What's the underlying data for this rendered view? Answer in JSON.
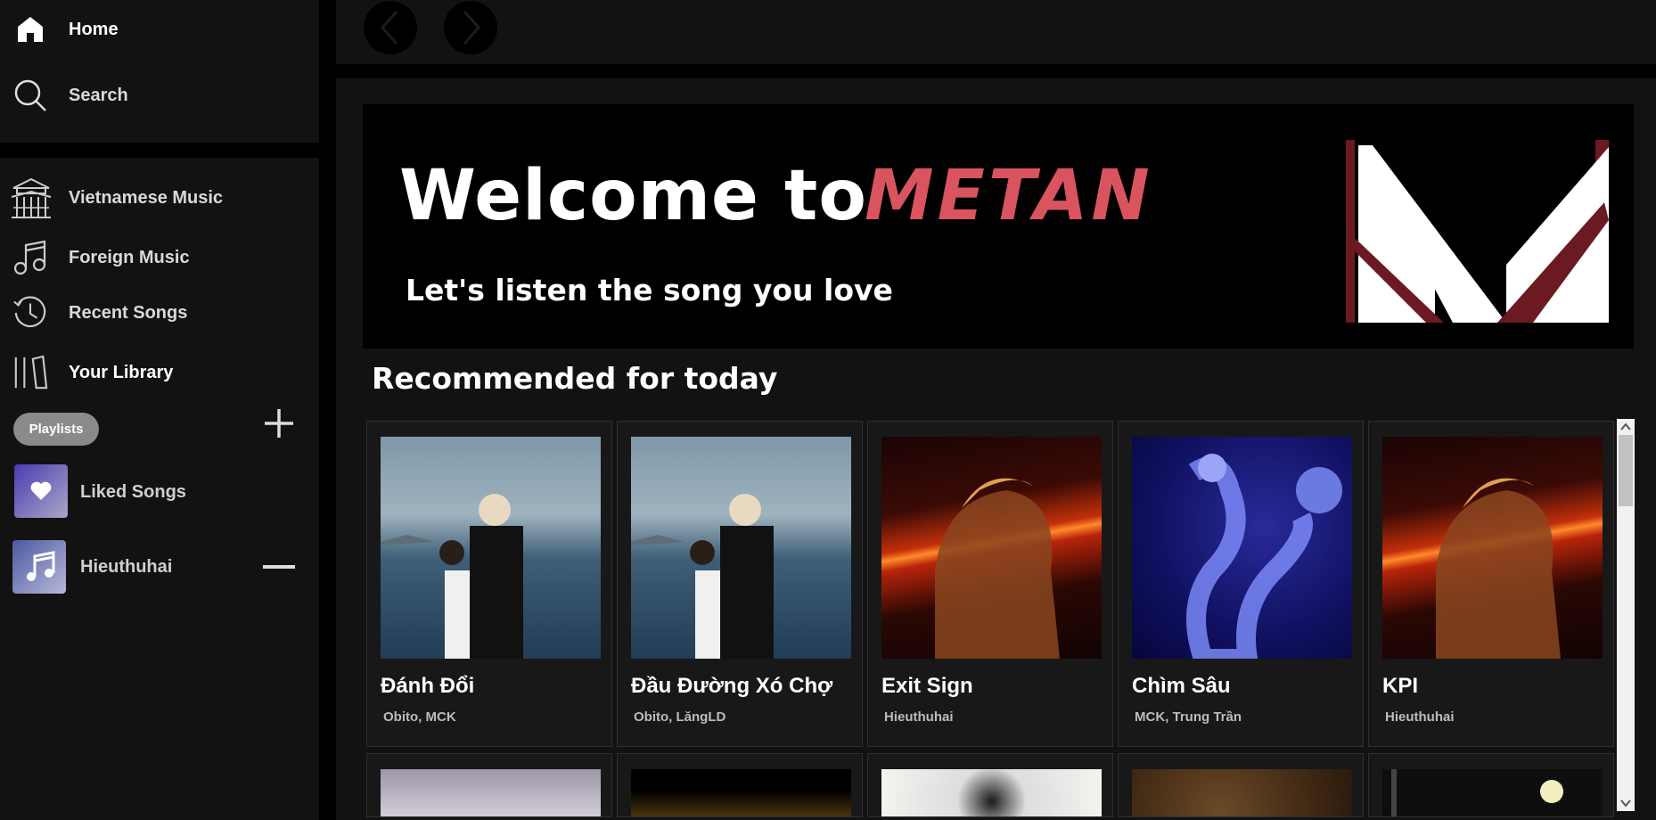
{
  "nav": {
    "home": "Home",
    "search": "Search"
  },
  "menu": {
    "vietnamese": "Vietnamese Music",
    "foreign": "Foreign Music",
    "recent": "Recent Songs",
    "library": "Your Library"
  },
  "playlists_pill": "Playlists",
  "playlists": [
    {
      "name": "Liked Songs"
    },
    {
      "name": "Hieuthuhai"
    }
  ],
  "banner": {
    "welcome": "Welcome to",
    "brand": "METAN",
    "tagline": "Let's listen the song you love"
  },
  "section_title": "Recommended for today",
  "cards": [
    {
      "title": "Đánh Đổi",
      "artist": "Obito, MCK"
    },
    {
      "title": "Đầu Đường Xó Chợ",
      "artist": "Obito, LăngLD"
    },
    {
      "title": "Exit Sign",
      "artist": "Hieuthuhai"
    },
    {
      "title": "Chìm Sâu",
      "artist": "MCK, Trung Trần"
    },
    {
      "title": "KPI",
      "artist": "Hieuthuhai"
    }
  ],
  "colors": {
    "accent": "#d9545f",
    "sidebar": "#121212",
    "background": "#000000"
  }
}
